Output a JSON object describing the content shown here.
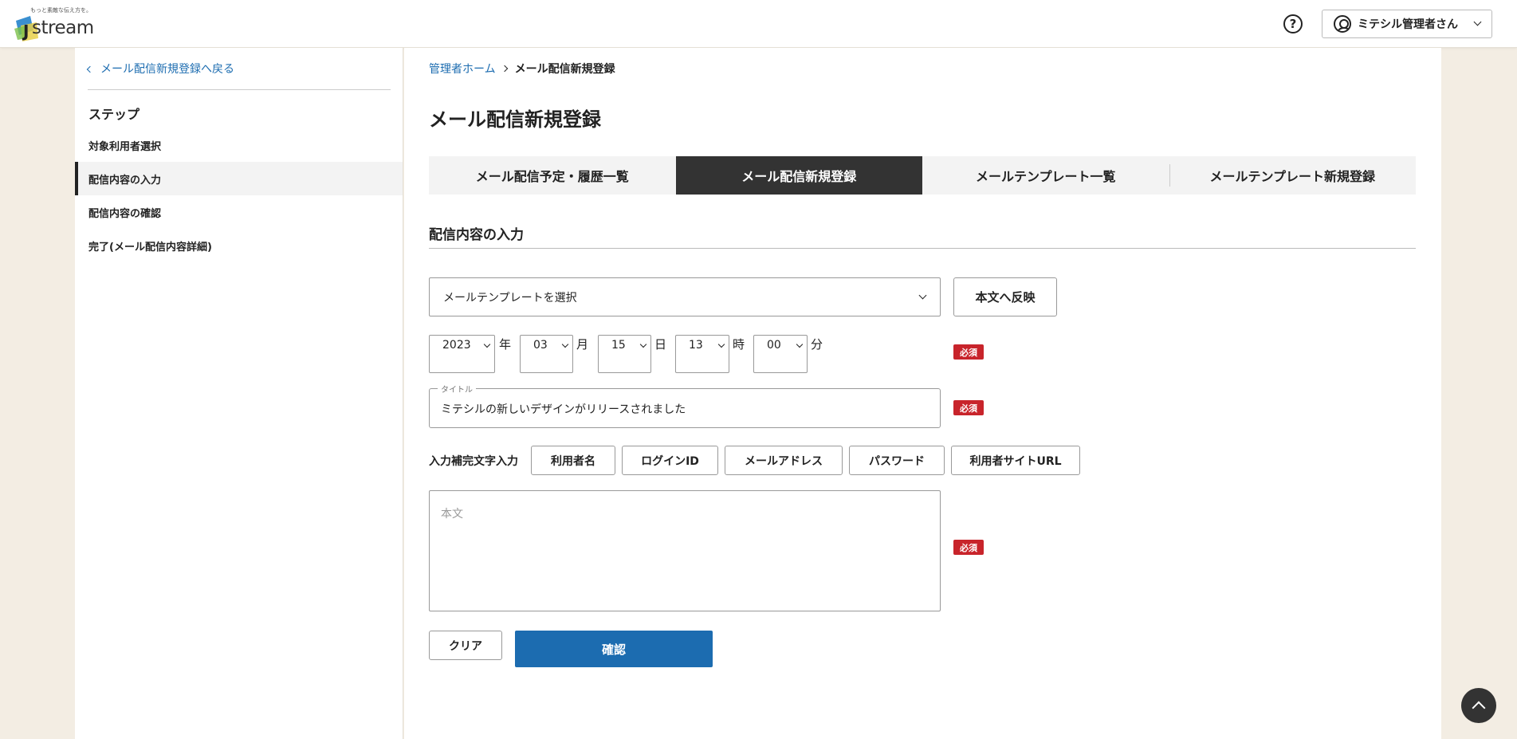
{
  "header": {
    "logo_tagline": "もっと素敵な伝え方を。",
    "logo_text": "stream",
    "user_name": "ミテシル管理者さん"
  },
  "sidebar": {
    "back_link": "メール配信新規登録へ戻る",
    "steps_heading": "ステップ",
    "steps": [
      {
        "label": "対象利用者選択",
        "active": false
      },
      {
        "label": "配信内容の入力",
        "active": true
      },
      {
        "label": "配信内容の確認",
        "active": false
      },
      {
        "label": "完了(メール配信内容詳細)",
        "active": false
      }
    ]
  },
  "breadcrumb": {
    "home": "管理者ホーム",
    "current": "メール配信新規登録"
  },
  "page_title": "メール配信新規登録",
  "tabs": [
    {
      "label": "メール配信予定・履歴一覧",
      "active": false
    },
    {
      "label": "メール配信新規登録",
      "active": true
    },
    {
      "label": "メールテンプレート一覧",
      "active": false
    },
    {
      "label": "メールテンプレート新規登録",
      "active": false
    }
  ],
  "form": {
    "section_title": "配信内容の入力",
    "template_select": "メールテンプレートを選択",
    "apply_button": "本文へ反映",
    "date": {
      "year": "2023",
      "year_label": "年",
      "month": "03",
      "month_label": "月",
      "day": "15",
      "day_label": "日",
      "hour": "13",
      "hour_label": "時",
      "minute": "00",
      "minute_label": "分"
    },
    "required_badge": "必須",
    "title_legend": "タイトル",
    "title_value": "ミテシルの新しいデザインがリリースされました",
    "insert_label": "入力補完文字入力",
    "insert_buttons": [
      "利用者名",
      "ログインID",
      "メールアドレス",
      "パスワード",
      "利用者サイトURL"
    ],
    "body_placeholder": "本文",
    "clear_button": "クリア",
    "confirm_button": "確認"
  },
  "colors": {
    "accent": "#1c6cb0",
    "required": "#c8242b",
    "background": "#f3ede3",
    "active_tab": "#333333"
  }
}
